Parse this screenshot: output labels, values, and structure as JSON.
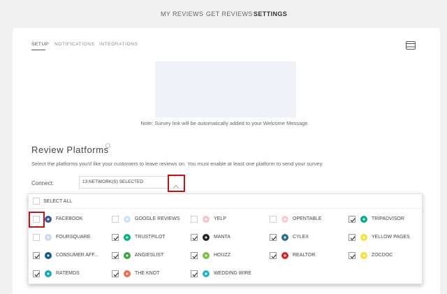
{
  "topnav": {
    "tabs": [
      {
        "label": "MY REVIEWS"
      },
      {
        "label": "GET REVIEWS"
      },
      {
        "label": "SETTINGS"
      }
    ]
  },
  "subtabs": [
    {
      "label": "SETUP"
    },
    {
      "label": "NOTIFICATIONS"
    },
    {
      "label": "INTEGRATIONS"
    }
  ],
  "note": "Note: Survey link will be automatically added to your Welcome Message.",
  "review_platforms": {
    "title": "Review Platforms",
    "description": "Select the platforms you'd like your customers to leave reviews on. You must enable at least one platform to send your survey.",
    "connect_label": "Connect:",
    "selected_text": "13 NETWORK(S) SELECTED",
    "select_all_label": "SELECT ALL",
    "platforms": [
      {
        "label": "FACEBOOK",
        "checked": false,
        "color": "#3b5998",
        "icon": "facebook-icon"
      },
      {
        "label": "GOOGLE REVIEWS",
        "checked": false,
        "color": "#4285f4",
        "icon": "google-icon"
      },
      {
        "label": "YELP",
        "checked": false,
        "color": "#d32323",
        "icon": "yelp-icon"
      },
      {
        "label": "OPENTABLE",
        "checked": false,
        "color": "#da3743",
        "icon": "opentable-icon"
      },
      {
        "label": "TRIPADVISOR",
        "checked": true,
        "color": "#00af87",
        "icon": "tripadvisor-icon"
      },
      {
        "label": "FOURSQUARE",
        "checked": false,
        "color": "#4a6bb0",
        "icon": "foursquare-icon"
      },
      {
        "label": "TRUSTPILOT",
        "checked": true,
        "color": "#00b67a",
        "icon": "trustpilot-icon"
      },
      {
        "label": "MANTA",
        "checked": true,
        "color": "#222222",
        "icon": "manta-icon"
      },
      {
        "label": "CYLEX",
        "checked": true,
        "color": "#2b6f8f",
        "icon": "cylex-icon"
      },
      {
        "label": "YELLOW PAGES",
        "checked": true,
        "color": "#f7e13b",
        "icon": "yellowpages-icon"
      },
      {
        "label": "CONSUMER AFF...",
        "checked": true,
        "color": "#0e5a8a",
        "icon": "consumer-affairs-icon"
      },
      {
        "label": "ANGIESLIST",
        "checked": true,
        "color": "#3ea341",
        "icon": "angieslist-icon"
      },
      {
        "label": "HOUZZ",
        "checked": true,
        "color": "#7ac142",
        "icon": "houzz-icon"
      },
      {
        "label": "REALTOR",
        "checked": true,
        "color": "#d92228",
        "icon": "realtor-icon"
      },
      {
        "label": "ZOCDOC",
        "checked": true,
        "color": "#f7e13b",
        "icon": "zocdoc-icon"
      },
      {
        "label": "RATEMDS",
        "checked": true,
        "color": "#14a8b8",
        "icon": "ratemds-icon"
      },
      {
        "label": "THE KNOT",
        "checked": true,
        "color": "#ef6a4c",
        "icon": "theknot-icon"
      },
      {
        "label": "WEDDING WIRE",
        "checked": true,
        "color": "#26b3c4",
        "icon": "weddingwire-icon"
      }
    ]
  },
  "colors": {
    "highlight": "#c0141b",
    "background": "#f1f1f1"
  }
}
